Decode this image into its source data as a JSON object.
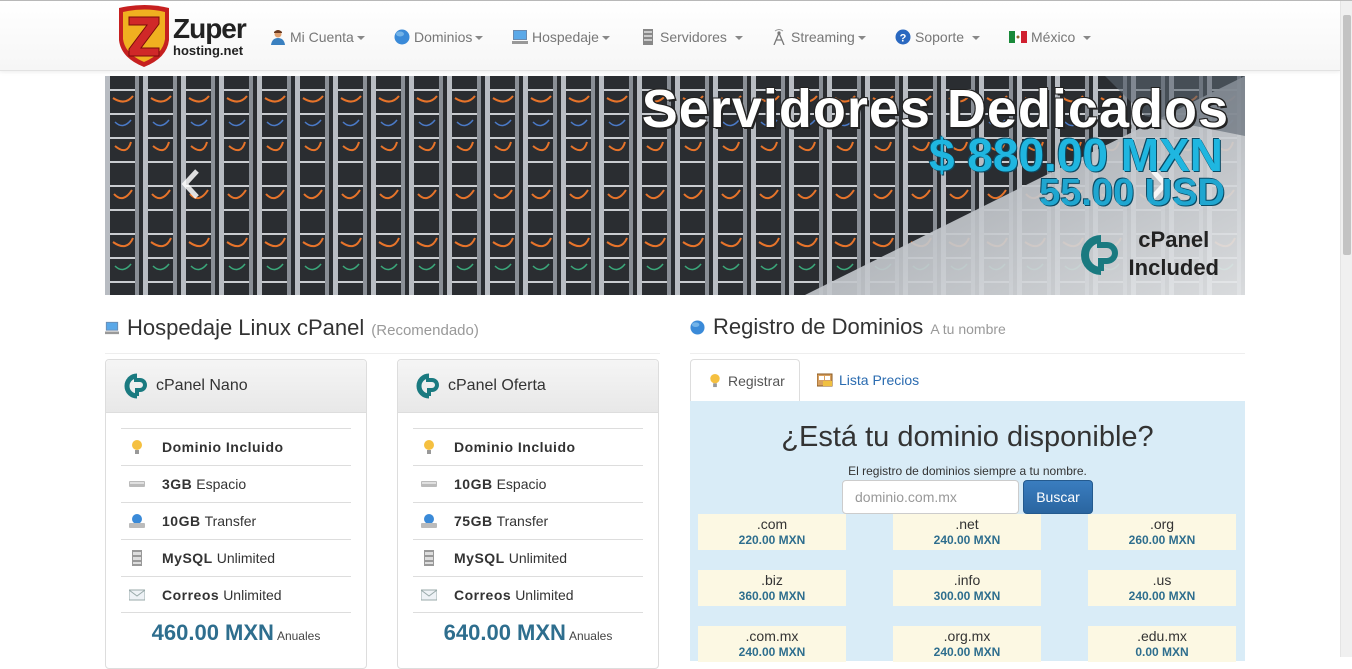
{
  "brand": {
    "name": "Zuper hosting.net",
    "line1": "Zuper",
    "line2": "hosting.net"
  },
  "nav": {
    "items": [
      {
        "label": "Mi Cuenta",
        "icon": "user-icon"
      },
      {
        "label": "Dominios",
        "icon": "globe-icon"
      },
      {
        "label": "Hospedaje",
        "icon": "computer-icon"
      },
      {
        "label": "Servidores",
        "icon": "server-icon"
      },
      {
        "label": "Streaming",
        "icon": "antenna-icon"
      },
      {
        "label": "Soporte",
        "icon": "help-icon"
      },
      {
        "label": "México",
        "icon": "mexico-flag-icon"
      }
    ]
  },
  "banner": {
    "title": "Servidores Dedicados",
    "price_mxn": "$ 880.00 MXN",
    "price_usd": "55.00 USD",
    "cpanel_line1": "cPanel",
    "cpanel_line2": "Included"
  },
  "hosting": {
    "title": "Hospedaje Linux cPanel",
    "subtitle": "(Recomendado)",
    "plans": [
      {
        "name": "cPanel Nano",
        "features": [
          {
            "bold": "Dominio Incluido",
            "text": "",
            "icon": "lightbulb-icon"
          },
          {
            "bold": "3GB",
            "text": "Espacio",
            "icon": "hard-drive-icon"
          },
          {
            "bold": "10GB",
            "text": "Transfer",
            "icon": "network-drive-icon"
          },
          {
            "bold": "MySQL",
            "text": "Unlimited",
            "icon": "database-icon"
          },
          {
            "bold": "Correos",
            "text": "Unlimited",
            "icon": "envelope-icon"
          }
        ],
        "price": "460.00 MXN",
        "period": "Anuales"
      },
      {
        "name": "cPanel Oferta",
        "features": [
          {
            "bold": "Dominio Incluido",
            "text": "",
            "icon": "lightbulb-icon"
          },
          {
            "bold": "10GB",
            "text": "Espacio",
            "icon": "hard-drive-icon"
          },
          {
            "bold": "75GB",
            "text": "Transfer",
            "icon": "network-drive-icon"
          },
          {
            "bold": "MySQL",
            "text": "Unlimited",
            "icon": "database-icon"
          },
          {
            "bold": "Correos",
            "text": "Unlimited",
            "icon": "envelope-icon"
          }
        ],
        "price": "640.00 MXN",
        "period": "Anuales"
      }
    ]
  },
  "domains": {
    "title": "Registro de Dominios",
    "subtitle": "A tu nombre",
    "tabs": [
      {
        "label": "Registrar",
        "icon": "lightbulb-icon",
        "active": true
      },
      {
        "label": "Lista Precios",
        "icon": "price-list-icon",
        "active": false
      }
    ],
    "heading": "¿Está tu dominio disponible?",
    "subheading": "El registro de dominios siempre a tu nombre.",
    "search_placeholder": "dominio.com.mx",
    "search_value": "",
    "search_button": "Buscar",
    "tlds": [
      {
        "name": ".com",
        "price": "220.00 MXN"
      },
      {
        "name": ".net",
        "price": "240.00 MXN"
      },
      {
        "name": ".org",
        "price": "260.00 MXN"
      },
      {
        "name": ".biz",
        "price": "360.00 MXN"
      },
      {
        "name": ".info",
        "price": "300.00 MXN"
      },
      {
        "name": ".us",
        "price": "240.00 MXN"
      },
      {
        "name": ".com.mx",
        "price": "240.00 MXN"
      },
      {
        "name": ".org.mx",
        "price": "240.00 MXN"
      },
      {
        "name": ".edu.mx",
        "price": "0.00 MXN"
      }
    ]
  },
  "colors": {
    "accent": "#2e6e8e",
    "link": "#2a6bb0",
    "domain_bg": "#d9ecf7",
    "tld_bg": "#fcf8e3",
    "button": "#2a65a0",
    "banner_price": "#1fb6e0"
  }
}
